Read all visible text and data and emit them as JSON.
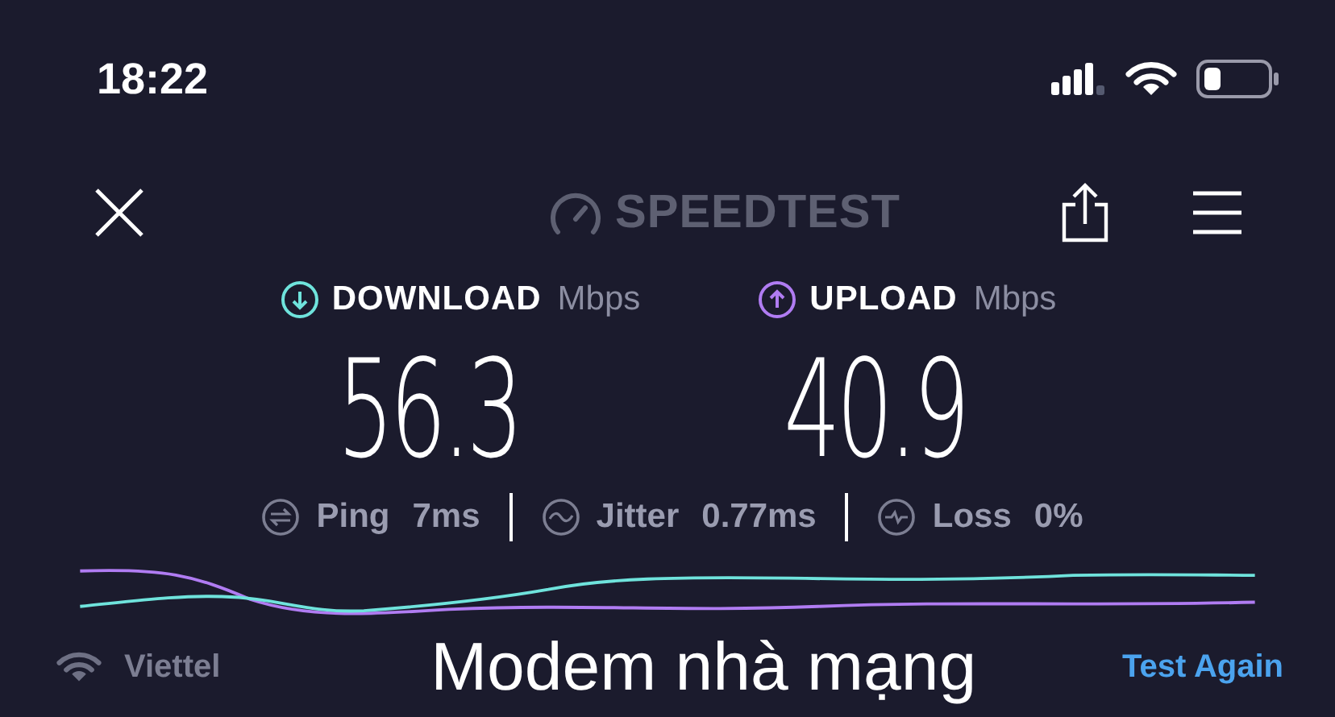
{
  "status_bar": {
    "time": "18:22"
  },
  "header": {
    "logo": "SPEEDTEST"
  },
  "results": [
    {
      "kind": "download",
      "label": "DOWNLOAD",
      "unit": "Mbps",
      "value": "56.3",
      "color": "#6fe3dc"
    },
    {
      "kind": "upload",
      "label": "UPLOAD",
      "unit": "Mbps",
      "value": "40.9",
      "color": "#b07cf2"
    }
  ],
  "stats": [
    {
      "kind": "ping",
      "label": "Ping",
      "value": "7ms"
    },
    {
      "kind": "jitter",
      "label": "Jitter",
      "value": "0.77ms"
    },
    {
      "kind": "loss",
      "label": "Loss",
      "value": "0%"
    }
  ],
  "footer": {
    "provider": "Viettel",
    "caption": "Modem nhà mạng",
    "action": "Test Again"
  }
}
